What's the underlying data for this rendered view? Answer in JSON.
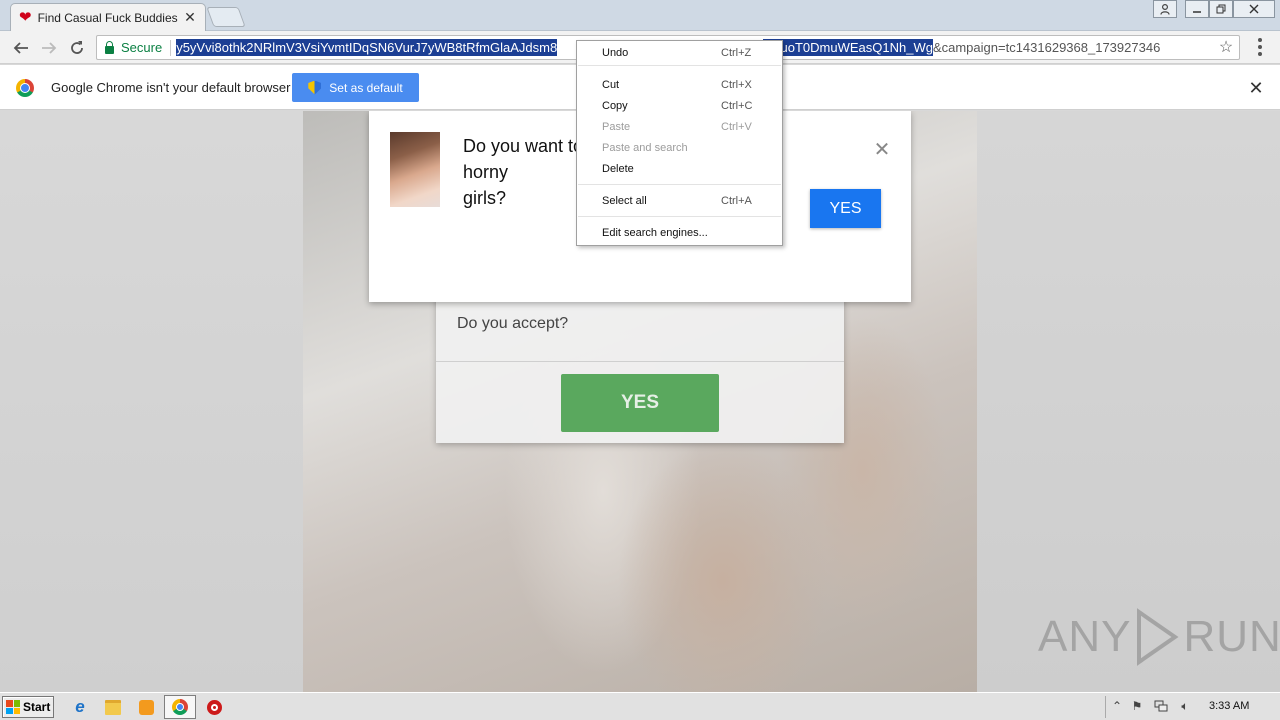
{
  "browser": {
    "tab": {
      "title": "Find Casual Fuck Buddies",
      "close": "✕"
    },
    "window_controls": {
      "user": "⚲",
      "min": "—",
      "max": "❐",
      "close": "✕"
    },
    "address": {
      "secure_label": "Secure",
      "url_selected": "y5yVvi8othk2NRlmV3VsiYvmtIDqSN6VurJ7yWB8tRfmGlaAJdsm8",
      "url_selected_tail": "McuoT0DmuWEasQ1Nh_Wg",
      "url_rest": "&campaign=tc1431629368_173927346"
    }
  },
  "infobar": {
    "message": "Google Chrome isn't your default browser",
    "button": "Set as default",
    "close": "✕"
  },
  "popup": {
    "question": "Do you want to chat with horny girls?",
    "question_visible_left": "Do you want to",
    "question_visible_right": "horny",
    "question_line2": "girls?",
    "close": "✕",
    "yes": "YES"
  },
  "accept_card": {
    "question": "Do you accept?",
    "yes": "YES"
  },
  "context_menu": {
    "items": [
      {
        "label": "Undo",
        "shortcut": "Ctrl+Z",
        "enabled": true
      },
      {
        "label": "Cut",
        "shortcut": "Ctrl+X",
        "enabled": true
      },
      {
        "label": "Copy",
        "shortcut": "Ctrl+C",
        "enabled": true
      },
      {
        "label": "Paste",
        "shortcut": "Ctrl+V",
        "enabled": false
      },
      {
        "label": "Paste and search",
        "shortcut": "",
        "enabled": false
      },
      {
        "label": "Delete",
        "shortcut": "",
        "enabled": true
      },
      {
        "label": "Select all",
        "shortcut": "Ctrl+A",
        "enabled": true
      },
      {
        "label": "Edit search engines...",
        "shortcut": "",
        "enabled": true
      }
    ]
  },
  "watermark": {
    "left": "ANY",
    "right": "RUN"
  },
  "taskbar": {
    "start": "Start",
    "clock": "3:33 AM"
  },
  "colors": {
    "accent_blue": "#1976f0",
    "accept_green": "#5aa85e",
    "secure_green": "#0b8043",
    "url_highlight": "#1c3f94"
  }
}
